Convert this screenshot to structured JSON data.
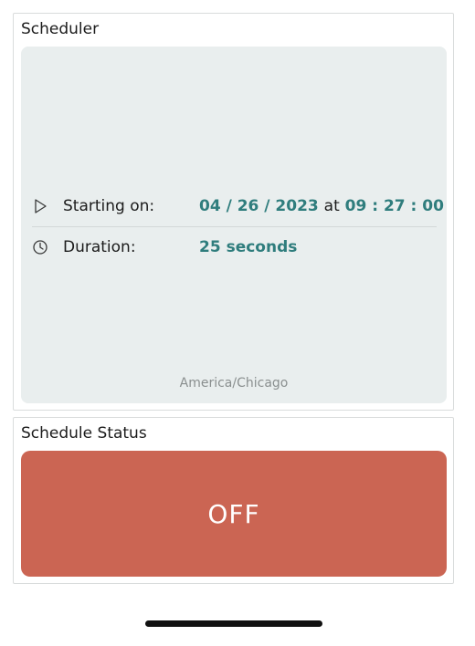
{
  "scheduler": {
    "title": "Scheduler",
    "starting_label": "Starting on:",
    "date": "04 / 26 / 2023",
    "at_word": "at",
    "time": "09 : 27 : 00",
    "duration_label": "Duration:",
    "duration_value": "25 seconds",
    "timezone": "America/Chicago",
    "icons": {
      "start": "play-outline-icon",
      "duration": "clock-icon"
    },
    "accent_color": "#2f7d7d"
  },
  "status": {
    "title": "Schedule Status",
    "button_label": "OFF",
    "button_color": "#cb6553"
  }
}
